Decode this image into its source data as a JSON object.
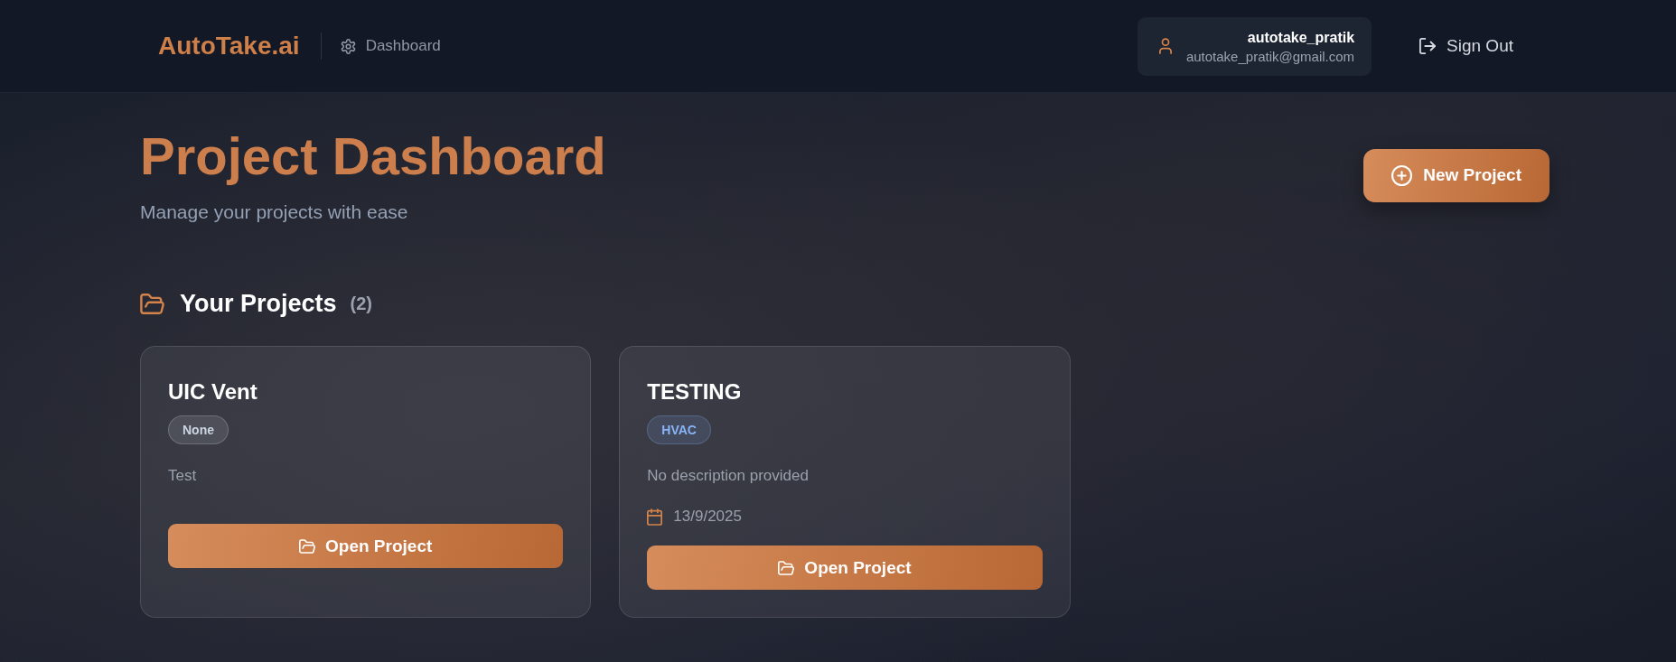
{
  "header": {
    "logo": "AutoTake.ai",
    "nav_link": "Dashboard",
    "user": {
      "name": "autotake_pratik",
      "email": "autotake_pratik@gmail.com"
    },
    "sign_out": "Sign Out"
  },
  "page": {
    "title": "Project Dashboard",
    "subtitle": "Manage your projects with ease",
    "new_button": "New Project"
  },
  "projects_section": {
    "heading": "Your Projects",
    "count": "(2)"
  },
  "projects": [
    {
      "name": "UIC Vent",
      "tag": {
        "label": "None",
        "color": "#cbd5e1"
      },
      "description": "Test",
      "button": "Open Project"
    },
    {
      "name": "TESTING",
      "tag": {
        "label": "HVAC",
        "color": "#8ab4f8"
      },
      "description": "No description provided",
      "date": "13/9/2025",
      "button": "Open Project"
    }
  ]
}
